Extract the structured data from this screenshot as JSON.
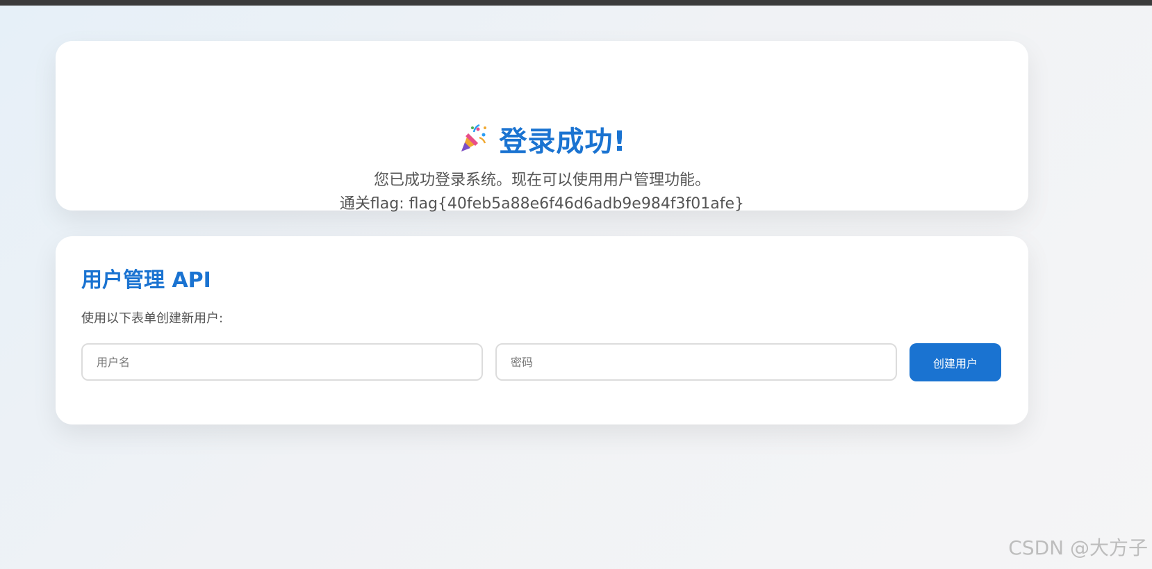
{
  "success": {
    "icon": "party-popper-icon",
    "title": "登录成功!",
    "message": "您已成功登录系统。现在可以使用用户管理功能。",
    "flag": "通关flag: flag{40feb5a88e6f46d6adb9e984f3f01afe}"
  },
  "api": {
    "title": "用户管理 API",
    "description": "使用以下表单创建新用户:",
    "username_placeholder": "用户名",
    "password_placeholder": "密码",
    "submit_label": "创建用户"
  },
  "watermark": "CSDN @大方子",
  "colors": {
    "accent": "#1a73d1",
    "text": "#555555",
    "card": "#ffffff"
  }
}
